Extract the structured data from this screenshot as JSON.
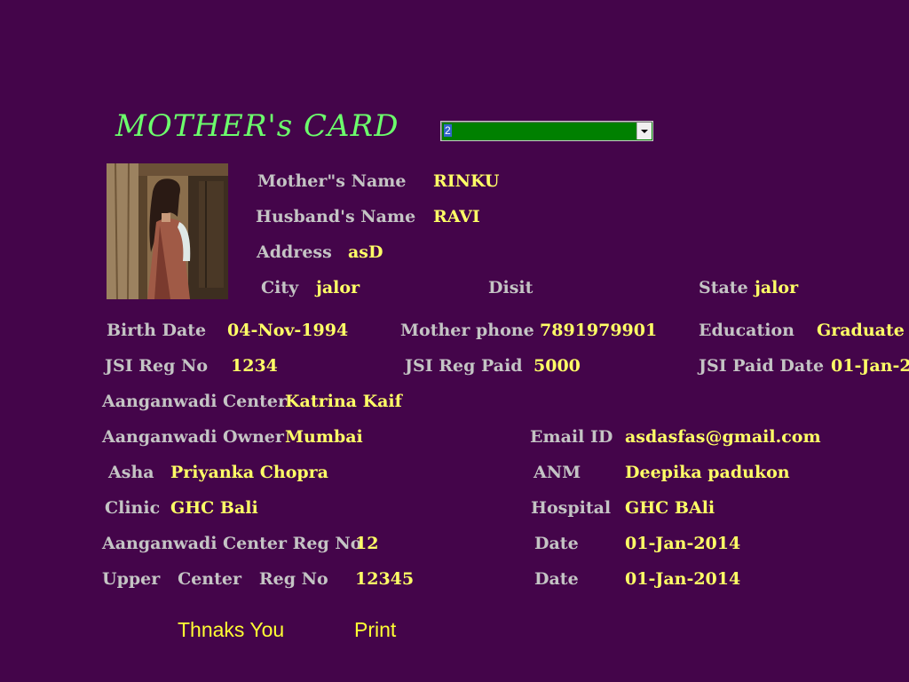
{
  "header": {
    "title": "MOTHER's CARD",
    "selector_value": "2"
  },
  "colors": {
    "background": "#44054a",
    "title": "#6cff6c",
    "label": "#c4c4c4",
    "value": "#ffff66",
    "selector_fill": "#008000"
  },
  "photo": {
    "icon": "mother-photo"
  },
  "fields": {
    "mother_name": {
      "label": "Mother\"s Name",
      "value": "RINKU"
    },
    "husband_name": {
      "label": "Husband's Name",
      "value": "RAVI"
    },
    "address": {
      "label": "Address",
      "value": "asD"
    },
    "city": {
      "label": "City",
      "value": "jalor"
    },
    "district": {
      "label": "Disit",
      "value": ""
    },
    "state": {
      "label": "State",
      "value": "jalor"
    },
    "birth_date": {
      "label": "Birth Date",
      "value": "04-Nov-1994"
    },
    "mother_phone": {
      "label": "Mother phone",
      "value": "7891979901"
    },
    "education": {
      "label": "Education",
      "value": "Graduate"
    },
    "jsi_reg_no": {
      "label": "JSI Reg No",
      "value": "1234"
    },
    "jsi_reg_paid": {
      "label": "JSI Reg Paid",
      "value": "5000"
    },
    "jsi_paid_date": {
      "label": "JSI Paid Date",
      "value": "01-Jan-2"
    },
    "aanganwadi_center": {
      "label": "Aanganwadi Center",
      "value": "Katrina Kaif"
    },
    "aanganwadi_owner": {
      "label": "Aanganwadi Owner",
      "value": "Mumbai"
    },
    "email": {
      "label": "Email ID",
      "value": "asdasfas@gmail.com"
    },
    "asha": {
      "label": "Asha",
      "value": "Priyanka Chopra"
    },
    "anm": {
      "label": "ANM",
      "value": "Deepika padukon"
    },
    "clinic": {
      "label": "Clinic",
      "value": "GHC Bali"
    },
    "hospital": {
      "label": "Hospital",
      "value": "GHC BAli"
    },
    "center_reg_no": {
      "label": "Aanganwadi Center Reg No",
      "value": "12"
    },
    "center_reg_date": {
      "label": "Date",
      "value": "01-Jan-2014"
    },
    "upper_reg_no": {
      "label": "Upper   Center   Reg No",
      "value": "12345"
    },
    "upper_reg_date": {
      "label": "Date",
      "value": "01-Jan-2014"
    }
  },
  "actions": {
    "thanks_label": "Thnaks You",
    "print_label": "Print"
  }
}
